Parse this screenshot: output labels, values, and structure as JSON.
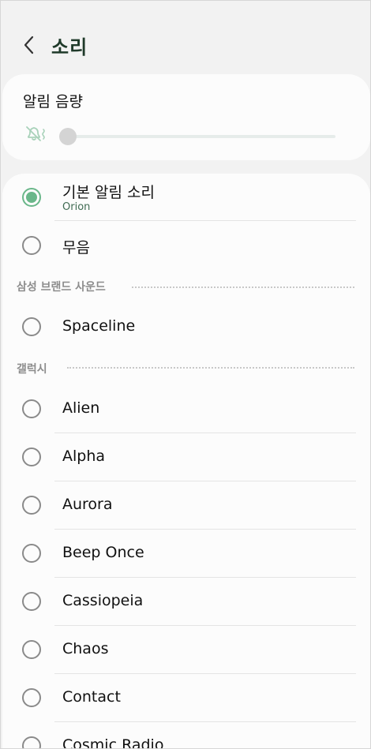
{
  "header": {
    "title": "소리"
  },
  "volume": {
    "title": "알림 음량",
    "level": 0
  },
  "icons": {
    "back": "chevron-left-icon",
    "mute": "bell-muted-icon"
  },
  "colors": {
    "accent": "#6ab78a",
    "title": "#1f3a2a",
    "subtitle": "#3f6b52"
  },
  "default_item": {
    "label": "기본 알림 소리",
    "current": "Orion",
    "selected": true
  },
  "silent_item": {
    "label": "무음",
    "selected": false
  },
  "sections": {
    "samsung": "삼성 브랜드 사운드",
    "galaxy": "갤럭시"
  },
  "samsung_items": [
    {
      "label": "Spaceline"
    }
  ],
  "galaxy_items": [
    {
      "label": "Alien"
    },
    {
      "label": "Alpha"
    },
    {
      "label": "Aurora"
    },
    {
      "label": "Beep Once"
    },
    {
      "label": "Cassiopeia"
    },
    {
      "label": "Chaos"
    },
    {
      "label": "Contact"
    },
    {
      "label": "Cosmic Radio"
    }
  ]
}
